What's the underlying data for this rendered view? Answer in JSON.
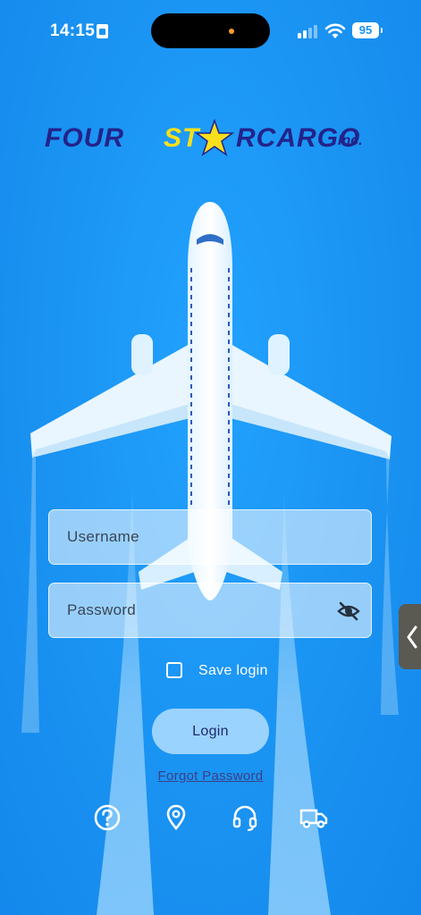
{
  "status_bar": {
    "time": "14:15",
    "battery": "95"
  },
  "logo": {
    "part1": "FOUR",
    "part2": "ST",
    "part3": "RCARGO",
    "part4": "Inc."
  },
  "form": {
    "username_placeholder": "Username",
    "password_placeholder": "Password",
    "save_login_label": "Save login",
    "save_login_checked": false,
    "login_label": "Login",
    "forgot_password_label": "Forgot Password"
  },
  "bottom_icons": [
    "help-icon",
    "location-pin-icon",
    "headset-icon",
    "truck-icon"
  ],
  "colors": {
    "background": "#1a93f2",
    "logo_navy": "#23238a",
    "logo_yellow": "#f7e01a",
    "login_button": "#9bd3ff",
    "login_text": "#1f2b6b",
    "link": "#3c3f86"
  }
}
